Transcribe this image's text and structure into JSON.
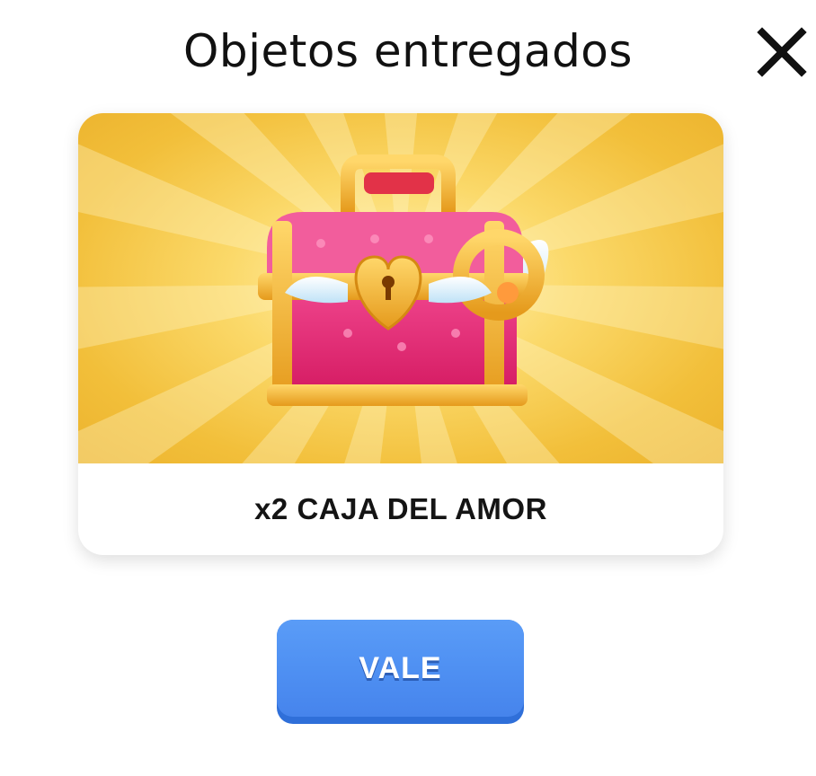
{
  "dialog": {
    "title": "Objetos entregados",
    "close_icon": "close-icon"
  },
  "reward": {
    "label": "x2 CAJA DEL AMOR",
    "image_icon": "love-chest-icon"
  },
  "actions": {
    "confirm_label": "VALE"
  },
  "colors": {
    "background": "#ffffff",
    "card_background": "#f2bf3a",
    "button": "#4e8ff2",
    "button_shadow": "#2f6fd9",
    "text": "#111111"
  }
}
